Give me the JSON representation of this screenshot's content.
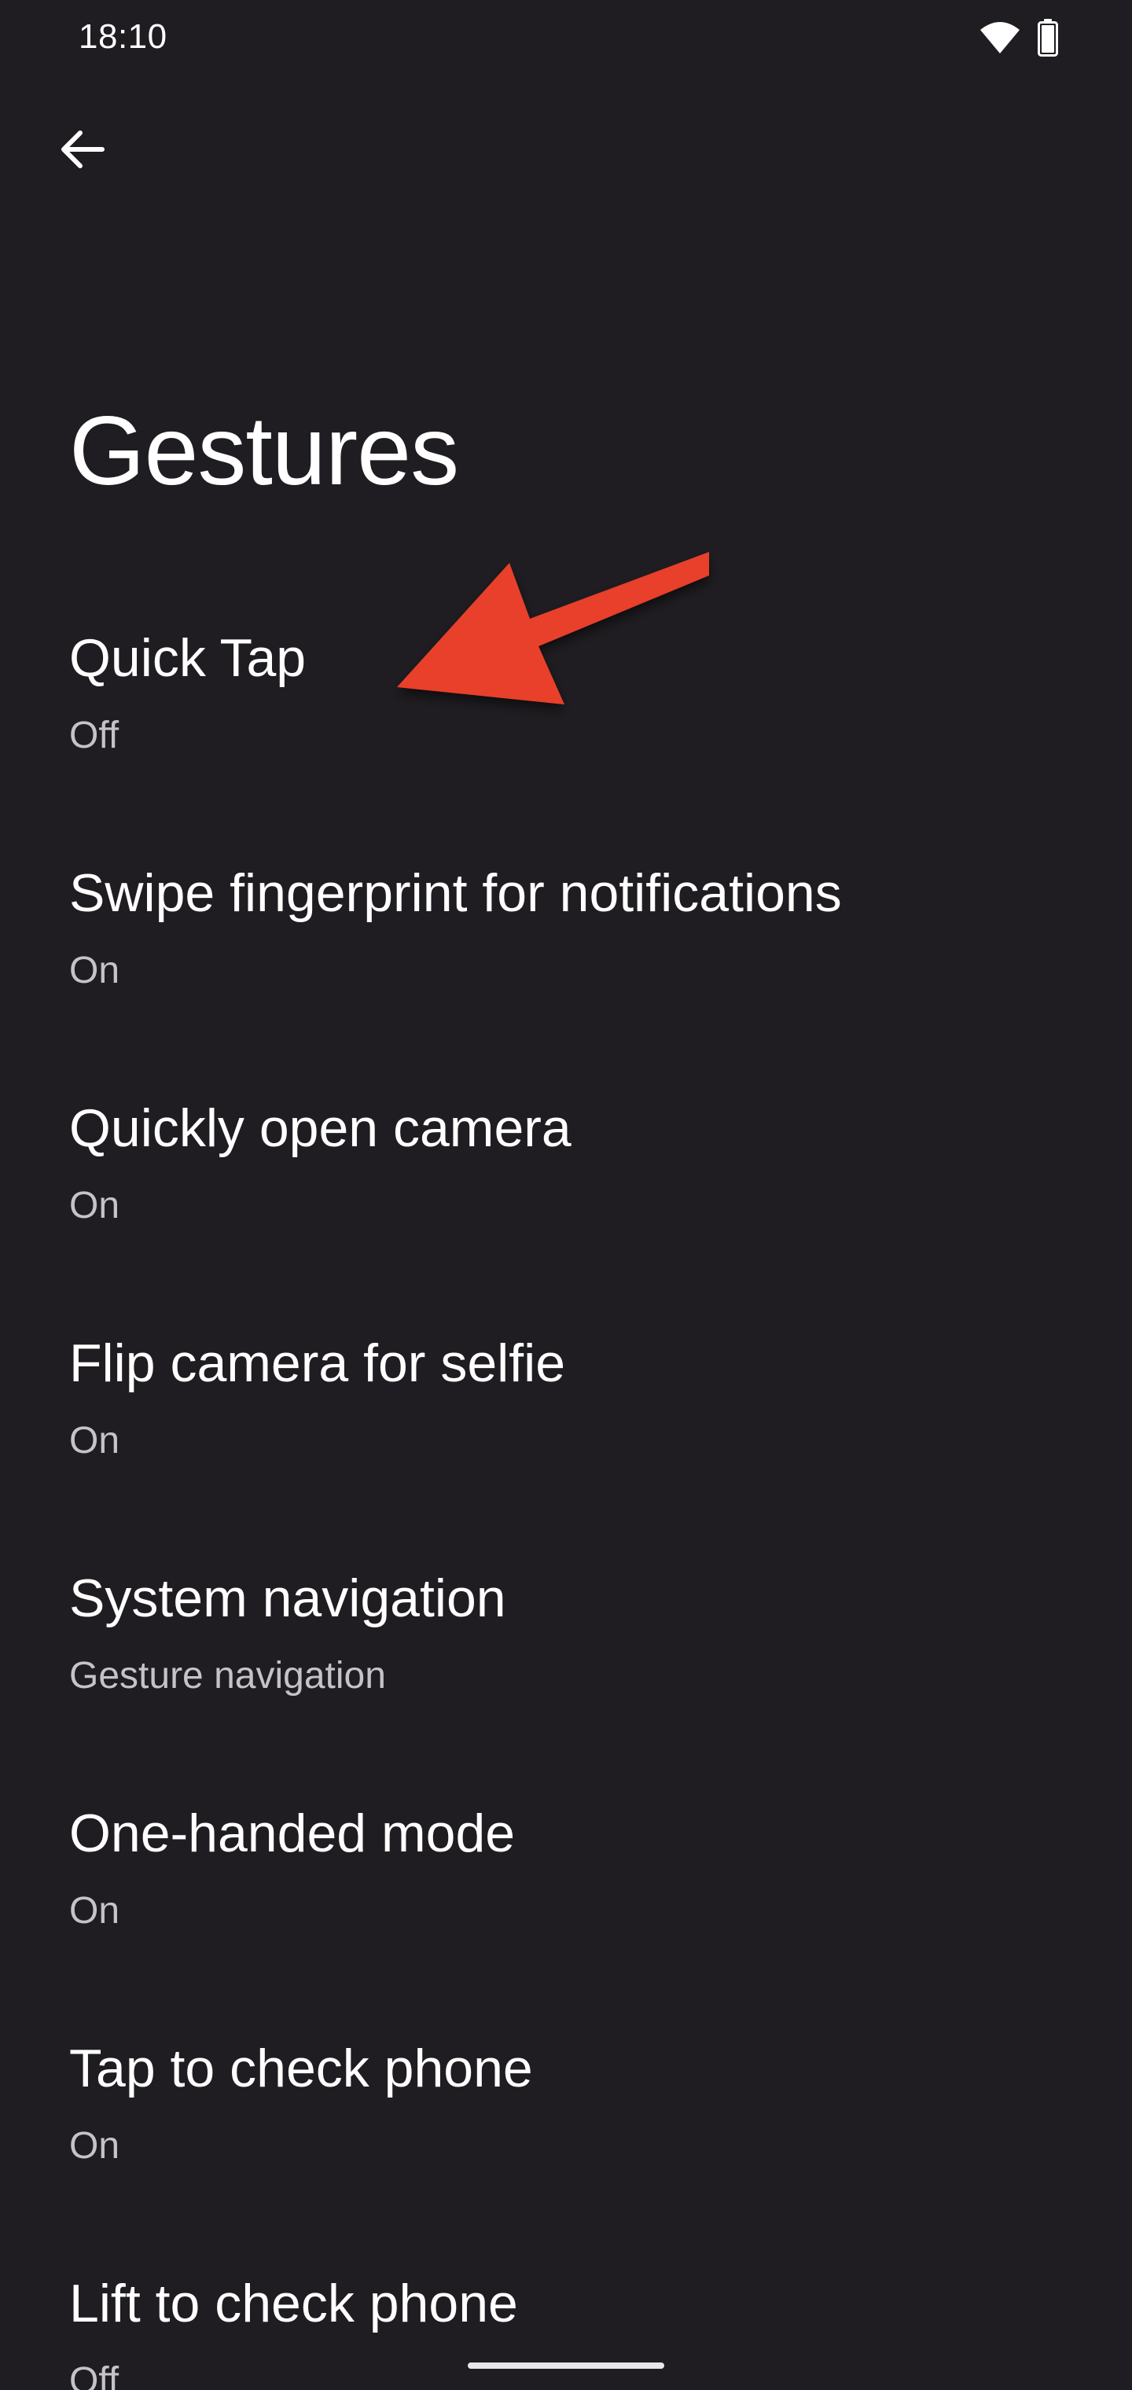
{
  "status_bar": {
    "time": "18:10",
    "icons": [
      "wifi-icon",
      "battery-icon"
    ]
  },
  "header": {
    "back_icon": "arrow-back-icon",
    "title": "Gestures"
  },
  "settings": [
    {
      "title": "Quick Tap",
      "summary": "Off"
    },
    {
      "title": "Swipe fingerprint for notifications",
      "summary": "On"
    },
    {
      "title": "Quickly open camera",
      "summary": "On"
    },
    {
      "title": "Flip camera for selfie",
      "summary": "On"
    },
    {
      "title": "System navigation",
      "summary": "Gesture navigation"
    },
    {
      "title": "One-handed mode",
      "summary": "On"
    },
    {
      "title": "Tap to check phone",
      "summary": "On"
    },
    {
      "title": "Lift to check phone",
      "summary": "Off"
    }
  ],
  "annotation": {
    "icon": "red-arrow-icon",
    "color": "#e8412c"
  },
  "colors": {
    "background": "#1f1d21",
    "title_text": "#ffffff",
    "summary_text": "#c5c2c9"
  }
}
